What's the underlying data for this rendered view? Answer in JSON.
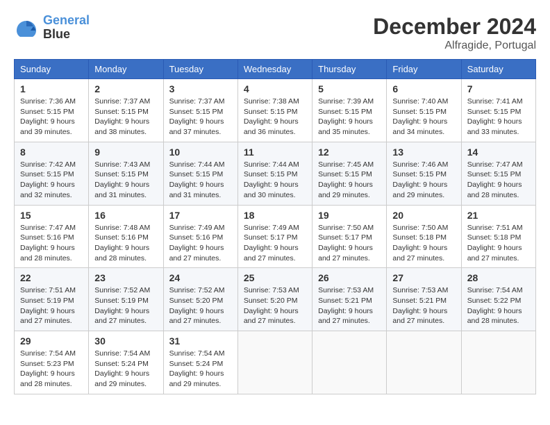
{
  "header": {
    "logo_line1": "General",
    "logo_line2": "Blue",
    "month": "December 2024",
    "location": "Alfragide, Portugal"
  },
  "weekdays": [
    "Sunday",
    "Monday",
    "Tuesday",
    "Wednesday",
    "Thursday",
    "Friday",
    "Saturday"
  ],
  "weeks": [
    [
      {
        "day": 1,
        "sunrise": "7:36 AM",
        "sunset": "5:15 PM",
        "daylight": "9 hours and 39 minutes."
      },
      {
        "day": 2,
        "sunrise": "7:37 AM",
        "sunset": "5:15 PM",
        "daylight": "9 hours and 38 minutes."
      },
      {
        "day": 3,
        "sunrise": "7:37 AM",
        "sunset": "5:15 PM",
        "daylight": "9 hours and 37 minutes."
      },
      {
        "day": 4,
        "sunrise": "7:38 AM",
        "sunset": "5:15 PM",
        "daylight": "9 hours and 36 minutes."
      },
      {
        "day": 5,
        "sunrise": "7:39 AM",
        "sunset": "5:15 PM",
        "daylight": "9 hours and 35 minutes."
      },
      {
        "day": 6,
        "sunrise": "7:40 AM",
        "sunset": "5:15 PM",
        "daylight": "9 hours and 34 minutes."
      },
      {
        "day": 7,
        "sunrise": "7:41 AM",
        "sunset": "5:15 PM",
        "daylight": "9 hours and 33 minutes."
      }
    ],
    [
      {
        "day": 8,
        "sunrise": "7:42 AM",
        "sunset": "5:15 PM",
        "daylight": "9 hours and 32 minutes."
      },
      {
        "day": 9,
        "sunrise": "7:43 AM",
        "sunset": "5:15 PM",
        "daylight": "9 hours and 31 minutes."
      },
      {
        "day": 10,
        "sunrise": "7:44 AM",
        "sunset": "5:15 PM",
        "daylight": "9 hours and 31 minutes."
      },
      {
        "day": 11,
        "sunrise": "7:44 AM",
        "sunset": "5:15 PM",
        "daylight": "9 hours and 30 minutes."
      },
      {
        "day": 12,
        "sunrise": "7:45 AM",
        "sunset": "5:15 PM",
        "daylight": "9 hours and 29 minutes."
      },
      {
        "day": 13,
        "sunrise": "7:46 AM",
        "sunset": "5:15 PM",
        "daylight": "9 hours and 29 minutes."
      },
      {
        "day": 14,
        "sunrise": "7:47 AM",
        "sunset": "5:15 PM",
        "daylight": "9 hours and 28 minutes."
      }
    ],
    [
      {
        "day": 15,
        "sunrise": "7:47 AM",
        "sunset": "5:16 PM",
        "daylight": "9 hours and 28 minutes."
      },
      {
        "day": 16,
        "sunrise": "7:48 AM",
        "sunset": "5:16 PM",
        "daylight": "9 hours and 28 minutes."
      },
      {
        "day": 17,
        "sunrise": "7:49 AM",
        "sunset": "5:16 PM",
        "daylight": "9 hours and 27 minutes."
      },
      {
        "day": 18,
        "sunrise": "7:49 AM",
        "sunset": "5:17 PM",
        "daylight": "9 hours and 27 minutes."
      },
      {
        "day": 19,
        "sunrise": "7:50 AM",
        "sunset": "5:17 PM",
        "daylight": "9 hours and 27 minutes."
      },
      {
        "day": 20,
        "sunrise": "7:50 AM",
        "sunset": "5:18 PM",
        "daylight": "9 hours and 27 minutes."
      },
      {
        "day": 21,
        "sunrise": "7:51 AM",
        "sunset": "5:18 PM",
        "daylight": "9 hours and 27 minutes."
      }
    ],
    [
      {
        "day": 22,
        "sunrise": "7:51 AM",
        "sunset": "5:19 PM",
        "daylight": "9 hours and 27 minutes."
      },
      {
        "day": 23,
        "sunrise": "7:52 AM",
        "sunset": "5:19 PM",
        "daylight": "9 hours and 27 minutes."
      },
      {
        "day": 24,
        "sunrise": "7:52 AM",
        "sunset": "5:20 PM",
        "daylight": "9 hours and 27 minutes."
      },
      {
        "day": 25,
        "sunrise": "7:53 AM",
        "sunset": "5:20 PM",
        "daylight": "9 hours and 27 minutes."
      },
      {
        "day": 26,
        "sunrise": "7:53 AM",
        "sunset": "5:21 PM",
        "daylight": "9 hours and 27 minutes."
      },
      {
        "day": 27,
        "sunrise": "7:53 AM",
        "sunset": "5:21 PM",
        "daylight": "9 hours and 27 minutes."
      },
      {
        "day": 28,
        "sunrise": "7:54 AM",
        "sunset": "5:22 PM",
        "daylight": "9 hours and 28 minutes."
      }
    ],
    [
      {
        "day": 29,
        "sunrise": "7:54 AM",
        "sunset": "5:23 PM",
        "daylight": "9 hours and 28 minutes."
      },
      {
        "day": 30,
        "sunrise": "7:54 AM",
        "sunset": "5:24 PM",
        "daylight": "9 hours and 29 minutes."
      },
      {
        "day": 31,
        "sunrise": "7:54 AM",
        "sunset": "5:24 PM",
        "daylight": "9 hours and 29 minutes."
      },
      null,
      null,
      null,
      null
    ]
  ]
}
